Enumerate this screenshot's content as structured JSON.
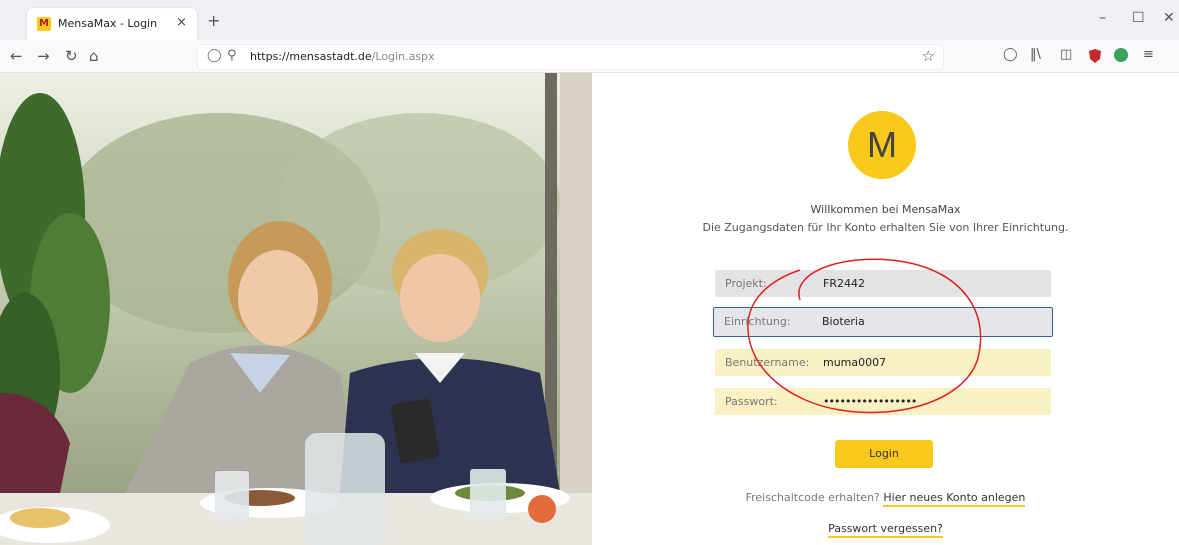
{
  "browser": {
    "tab_title": "MensaMax - Login",
    "tab_favicon": "M",
    "tab_close": "×",
    "new_tab": "+",
    "url_host": "https://mensastadt.de",
    "url_path": "/Login.aspx"
  },
  "login": {
    "logo_letter": "M",
    "welcome": "Willkommen bei MensaMax",
    "subtitle": "Die Zugangsdaten für Ihr Konto erhalten Sie von Ihrer Einrichtung.",
    "fields": [
      {
        "label": "Projekt:",
        "value": "FR2442"
      },
      {
        "label": "Einrichtung:",
        "value": "Bioteria"
      },
      {
        "label": "Benutzername:",
        "value": "muma0007"
      },
      {
        "label": "Passwort:",
        "value": "•••••••••••••••••"
      }
    ],
    "login_button": "Login",
    "register_prompt": "Freischaltcode erhalten?",
    "register_link": "Hier neues Konto anlegen",
    "forgot_link": "Passwort vergessen?"
  },
  "colors": {
    "brand_yellow": "#f8c81a",
    "annotation_red": "#e02020",
    "focus_border": "#3060a8"
  },
  "icons": [
    "back-icon",
    "forward-icon",
    "reload-icon",
    "home-icon",
    "shield-icon",
    "lock-icon",
    "star-icon",
    "pocket-icon",
    "library-icon",
    "sidebar-icon",
    "ublock-icon",
    "extension-icon",
    "menu-icon",
    "minimize-icon",
    "maximize-icon",
    "close-window-icon"
  ]
}
